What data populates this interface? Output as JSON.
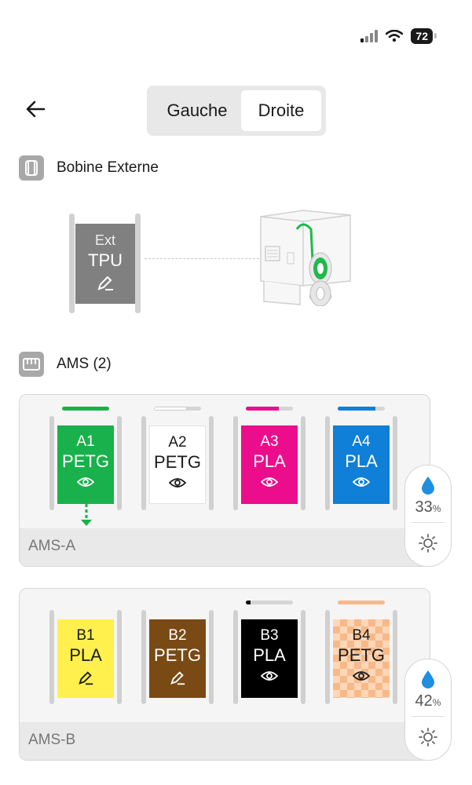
{
  "status": {
    "battery": "72"
  },
  "header": {
    "segments": [
      "Gauche",
      "Droite"
    ],
    "selected": "Droite"
  },
  "external": {
    "title": "Bobine Externe",
    "spool": {
      "label": "Ext",
      "material": "TPU",
      "color": "#808080",
      "icon": "edit-icon"
    }
  },
  "ams_section": {
    "title": "AMS (2)"
  },
  "ams": [
    {
      "name": "AMS-A",
      "humidity": "33",
      "humidity_unit": "%",
      "slots": [
        {
          "id": "A1",
          "material": "PETG",
          "color": "#19b14b",
          "text_color": "#ffffff",
          "remaining": 1.0,
          "bar_color": "#19b14b",
          "icon": "eye-icon"
        },
        {
          "id": "A2",
          "material": "PETG",
          "color": "#ffffff",
          "text_color": "#1a1a1a",
          "remaining": 0.7,
          "bar_color": "#ffffff",
          "icon": "eye-icon"
        },
        {
          "id": "A3",
          "material": "PLA",
          "color": "#ec0d8c",
          "text_color": "#ffffff",
          "remaining": 0.7,
          "bar_color": "#ec0d8c",
          "icon": "eye-icon"
        },
        {
          "id": "A4",
          "material": "PLA",
          "color": "#0f7fd8",
          "text_color": "#ffffff",
          "remaining": 0.8,
          "bar_color": "#0f7fd8",
          "icon": "eye-icon"
        }
      ]
    },
    {
      "name": "AMS-B",
      "humidity": "42",
      "humidity_unit": "%",
      "slots": [
        {
          "id": "B1",
          "material": "PLA",
          "color": "#fff04d",
          "text_color": "#1a1a1a",
          "icon": "edit-icon"
        },
        {
          "id": "B2",
          "material": "PETG",
          "color": "#7a4a14",
          "text_color": "#ffffff",
          "icon": "edit-icon"
        },
        {
          "id": "B3",
          "material": "PLA",
          "color": "#000000",
          "text_color": "#ffffff",
          "remaining": 0.1,
          "bar_color": "#111111",
          "icon": "eye-icon"
        },
        {
          "id": "B4",
          "material": "PETG",
          "color": "#f7b98a",
          "text_color": "#1a1a1a",
          "remaining": 1.0,
          "bar_color": "#f7b98a",
          "icon": "eye-icon",
          "pattern": "checker"
        }
      ]
    }
  ]
}
